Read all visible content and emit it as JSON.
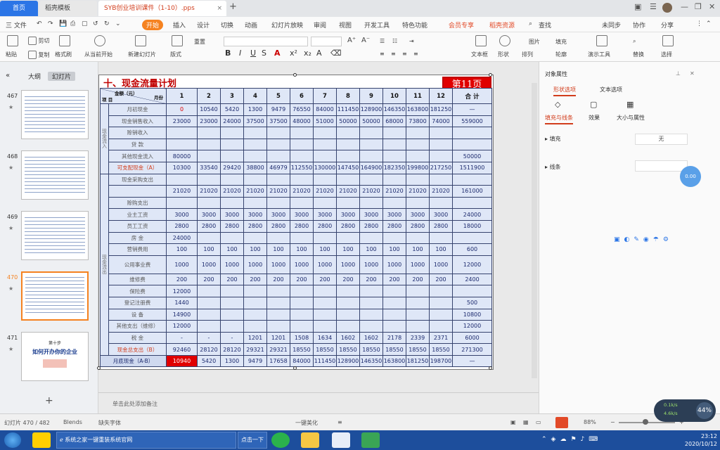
{
  "tabs": {
    "home": "首页",
    "t1": "稻壳模板",
    "t2": "SYB创业培训课件（1-10）.pps"
  },
  "menu": [
    "三 文件",
    "开始",
    "插入",
    "设计",
    "切换",
    "动画",
    "幻灯片放映",
    "审阅",
    "视图",
    "开发工具",
    "特色功能",
    "会员专享",
    "稻壳资源",
    "查找"
  ],
  "menu_right": [
    "未同步",
    "协作",
    "分享"
  ],
  "ribbon": {
    "paste": "粘贴",
    "cut": "剪切",
    "copy": "复制",
    "format_painter": "格式刷",
    "from_start": "从当前开始",
    "new_slide": "新建幻灯片",
    "layout": "版式",
    "reset": "重置",
    "textbox": "文本框",
    "shapes": "形状",
    "arrange": "排列",
    "picture": "图片",
    "fill": "填充",
    "outline": "轮廓",
    "presentation_tool": "演示工具",
    "replace": "替换",
    "select": "选择"
  },
  "left_panel": {
    "outline_tab": "大纲",
    "slides_tab": "幻灯片"
  },
  "thumbs": [
    {
      "num": "467",
      "selected": false,
      "kind": "table"
    },
    {
      "num": "468",
      "selected": false,
      "kind": "table"
    },
    {
      "num": "469",
      "selected": false,
      "kind": "table"
    },
    {
      "num": "470",
      "selected": true,
      "kind": "table"
    },
    {
      "num": "471",
      "selected": false,
      "kind": "title",
      "small": "第十步",
      "title": "如何开办你的企业"
    }
  ],
  "slide": {
    "title": "十、现金流量计划",
    "page_badge": "第11页",
    "corner_amount": "金额（元）",
    "corner_month": "月份",
    "corner_item": "项  目",
    "months": [
      "1",
      "2",
      "3",
      "4",
      "5",
      "6",
      "7",
      "8",
      "9",
      "10",
      "11",
      "12",
      "合  计"
    ],
    "side_in": "现金流入",
    "side_out": "现金流出",
    "rows": [
      {
        "label": "月初现金",
        "vals": [
          "0",
          "10540",
          "5420",
          "1300",
          "9479",
          "76550",
          "84000",
          "111450",
          "128900",
          "146350",
          "163800",
          "181250",
          "—"
        ]
      },
      {
        "label": "现金销售收入",
        "vals": [
          "23000",
          "23000",
          "24000",
          "37500",
          "37500",
          "48000",
          "51000",
          "50000",
          "50000",
          "68000",
          "73800",
          "74000",
          "559000"
        ]
      },
      {
        "label": "赊销收入",
        "vals": [
          "",
          "",
          "",
          "",
          "",
          "",
          "",
          "",
          "",
          "",
          "",
          "",
          ""
        ]
      },
      {
        "label": "贷      款",
        "vals": [
          "",
          "",
          "",
          "",
          "",
          "",
          "",
          "",
          "",
          "",
          "",
          "",
          ""
        ]
      },
      {
        "label": "其他现金流入",
        "vals": [
          "80000",
          "",
          "",
          "",
          "",
          "",
          "",
          "",
          "",
          "",
          "",
          "",
          "50000"
        ]
      },
      {
        "label": "可支配现金（A）",
        "red": true,
        "vals": [
          "10300",
          "33540",
          "29420",
          "38800",
          "46979",
          "112550",
          "130000",
          "147450",
          "164900",
          "182350",
          "199800",
          "217250",
          "1511900"
        ]
      },
      {
        "label": "现金采购支出",
        "vals": [
          "",
          "",
          "",
          "",
          "",
          "",
          "",
          "",
          "",
          "",
          "",
          "",
          ""
        ]
      },
      {
        "label": "",
        "vals": [
          "21020",
          "21020",
          "21020",
          "21020",
          "21020",
          "21020",
          "21020",
          "21020",
          "21020",
          "21020",
          "21020",
          "21020",
          "161000"
        ]
      },
      {
        "label": "赊购支出",
        "vals": [
          "",
          "",
          "",
          "",
          "",
          "",
          "",
          "",
          "",
          "",
          "",
          "",
          ""
        ]
      },
      {
        "label": "业主工资",
        "vals": [
          "3000",
          "3000",
          "3000",
          "3000",
          "3000",
          "3000",
          "3000",
          "3000",
          "3000",
          "3000",
          "3000",
          "3000",
          "24000"
        ]
      },
      {
        "label": "员工工资",
        "vals": [
          "2800",
          "2800",
          "2800",
          "2800",
          "2800",
          "2800",
          "2800",
          "2800",
          "2800",
          "2800",
          "2800",
          "2800",
          "18000"
        ]
      },
      {
        "label": "房     金",
        "vals": [
          "24000",
          "",
          "",
          "",
          "",
          "",
          "",
          "",
          "",
          "",
          "",
          "",
          ""
        ]
      },
      {
        "label": "营销费用",
        "vals": [
          "100",
          "100",
          "100",
          "100",
          "100",
          "100",
          "100",
          "100",
          "100",
          "100",
          "100",
          "100",
          "600"
        ]
      },
      {
        "label": "公用事业费",
        "tall": true,
        "vals": [
          "1000",
          "1000",
          "1000",
          "1000",
          "1000",
          "1000",
          "1000",
          "1000",
          "1000",
          "1000",
          "1000",
          "1000",
          "12000"
        ]
      },
      {
        "label": "维修费",
        "vals": [
          "200",
          "200",
          "200",
          "200",
          "200",
          "200",
          "200",
          "200",
          "200",
          "200",
          "200",
          "200",
          "2400"
        ]
      },
      {
        "label": "保险费",
        "vals": [
          "12000",
          "",
          "",
          "",
          "",
          "",
          "",
          "",
          "",
          "",
          "",
          "",
          ""
        ]
      },
      {
        "label": "登记注册费",
        "vals": [
          "1440",
          "",
          "",
          "",
          "",
          "",
          "",
          "",
          "",
          "",
          "",
          "",
          "500"
        ]
      },
      {
        "label": "设     备",
        "vals": [
          "14900",
          "",
          "",
          "",
          "",
          "",
          "",
          "",
          "",
          "",
          "",
          "",
          "10800"
        ]
      },
      {
        "label": "其他支出（维修）",
        "vals": [
          "12000",
          "",
          "",
          "",
          "",
          "",
          "",
          "",
          "",
          "",
          "",
          "",
          "12000"
        ]
      },
      {
        "label": "税     金",
        "vals": [
          "-",
          "-",
          "-",
          "1201",
          "1201",
          "1508",
          "1634",
          "1602",
          "1602",
          "2178",
          "2339",
          "2371",
          "6000"
        ]
      },
      {
        "label": "现金总支出（B）",
        "red": true,
        "vals": [
          "92460",
          "28120",
          "28120",
          "29321",
          "29321",
          "18550",
          "18550",
          "18550",
          "18550",
          "18550",
          "18550",
          "18550",
          "271300"
        ]
      },
      {
        "label": "月底现金（A-B）",
        "dark": true,
        "vals": [
          "10940",
          "5420",
          "1300",
          "9479",
          "17658",
          "84000",
          "111450",
          "128900",
          "146350",
          "163800",
          "181250",
          "198700",
          "—"
        ]
      }
    ],
    "highlight": {
      "row": 21,
      "col": 0
    }
  },
  "notes_placeholder": "单击此处添加备注",
  "right_panel": {
    "title": "对象属性",
    "tabs": [
      "形状选项",
      "文本选项"
    ],
    "subtabs": [
      "填充与线条",
      "效果",
      "大小与属性"
    ],
    "fill_label": "填充",
    "fill_value": "无",
    "line_label": "线条",
    "bubble": "0.00"
  },
  "status": {
    "slide_info": "幻灯片 470 / 482",
    "theme": "Blends",
    "font_missing": "缺失字体",
    "smart_beautify": "一键美化",
    "zoom": "88%"
  },
  "net": {
    "pct": "44%",
    "up": "0.1k/s",
    "down": "4.6k/s"
  },
  "taskbar": {
    "item1": "系统之家一键重装系统官网",
    "item2": "点击一下"
  },
  "clock": {
    "time": "23:12",
    "date": "2020/10/12"
  }
}
